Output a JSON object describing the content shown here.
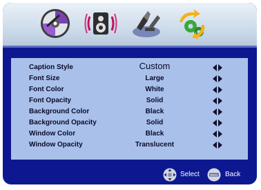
{
  "menu_icons": [
    {
      "name": "disc-icon"
    },
    {
      "name": "speaker-icon"
    },
    {
      "name": "tools-icon"
    },
    {
      "name": "settings-gears-icon"
    }
  ],
  "caption_settings": [
    {
      "label": "Caption Style",
      "value": "Custom"
    },
    {
      "label": "Font Size",
      "value": "Large"
    },
    {
      "label": "Font Color",
      "value": "White"
    },
    {
      "label": "Font Opacity",
      "value": "Solid"
    },
    {
      "label": "Background Color",
      "value": "Black"
    },
    {
      "label": "Background Opacity",
      "value": "Solid"
    },
    {
      "label": "Window Color",
      "value": "Black"
    },
    {
      "label": "Window Opacity",
      "value": "Translucent"
    }
  ],
  "footer": {
    "select_label": "Select",
    "back_label": "Back",
    "menu_button_text": "MENU"
  },
  "colors": {
    "screen_background": "#0d1890",
    "menu_panel": "#a9c1ea",
    "footer_text": "#ffffff"
  }
}
